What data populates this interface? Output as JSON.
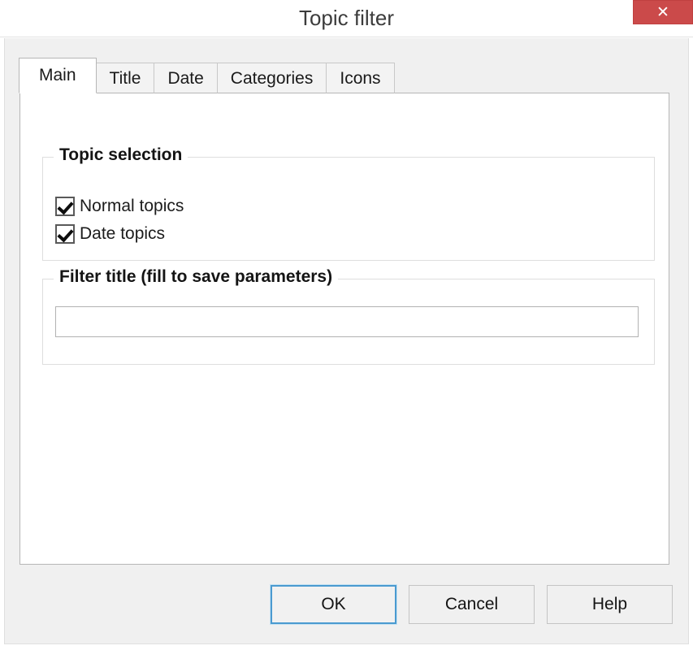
{
  "window": {
    "title": "Topic filter",
    "close_icon": "close-icon",
    "close_glyph": "✕",
    "close_color": "#cb4a4a"
  },
  "tabs": [
    {
      "label": "Main",
      "active": true
    },
    {
      "label": "Title",
      "active": false
    },
    {
      "label": "Date",
      "active": false
    },
    {
      "label": "Categories",
      "active": false
    },
    {
      "label": "Icons",
      "active": false
    }
  ],
  "main_tab": {
    "topic_selection": {
      "legend": "Topic selection",
      "options": [
        {
          "label": "Normal topics",
          "checked": true
        },
        {
          "label": "Date topics",
          "checked": true
        }
      ]
    },
    "filter_title": {
      "legend": "Filter title (fill to save parameters)",
      "input_value": "",
      "input_placeholder": ""
    }
  },
  "footer": {
    "ok_label": "OK",
    "cancel_label": "Cancel",
    "help_label": "Help",
    "focus_color": "#4a9ad0"
  }
}
